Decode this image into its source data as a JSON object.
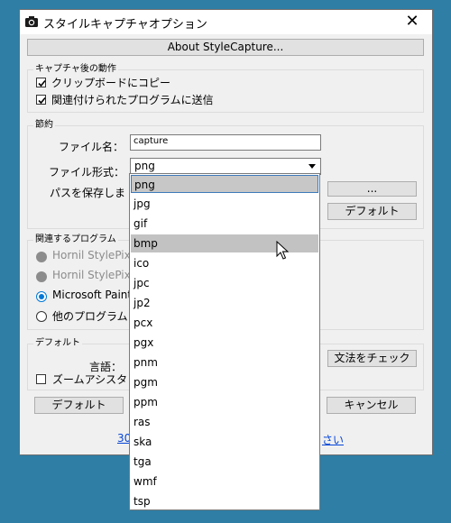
{
  "window": {
    "title": "スタイルキャプチャオプション"
  },
  "about_button": "About StyleCapture...",
  "capture_group": {
    "title": "キャプチャ後の動作",
    "options": [
      {
        "label": "クリップボードにコピー",
        "checked": true
      },
      {
        "label": "関連付けられたプログラムに送信",
        "checked": true
      }
    ]
  },
  "save_group": {
    "title": "節約",
    "filename_label": "ファイル名：",
    "filename_value": "capture",
    "format_label": "ファイル形式：",
    "format_value": "png",
    "path_label": "パスを保存しま",
    "browse_button": "...",
    "default_button": "デフォルト"
  },
  "program_group": {
    "title": "関連するプログラム",
    "options": [
      {
        "label": "Hornil StylePix",
        "selected": false,
        "enabled": false
      },
      {
        "label": "Hornil StylePix",
        "selected": false,
        "enabled": false
      },
      {
        "label": "Microsoft Paint",
        "selected": true,
        "enabled": true
      },
      {
        "label": "他のプログラム",
        "selected": false,
        "enabled": true
      }
    ]
  },
  "default_group": {
    "title": "デフォルト",
    "language_label": "言語：",
    "grammar_button": "文法をチェック",
    "zoom_assist_label": "ズームアシスタ",
    "zoom_assist_checked": false
  },
  "footer": {
    "default_button": "デフォルト",
    "cancel_button": "キャンセル",
    "link_left": "30",
    "link_right": "さい"
  },
  "dropdown": {
    "items": [
      "png",
      "jpg",
      "gif",
      "bmp",
      "ico",
      "jpc",
      "jp2",
      "pcx",
      "pgx",
      "pnm",
      "pgm",
      "ppm",
      "ras",
      "ska",
      "tga",
      "wmf",
      "tsp"
    ],
    "selected_index": 0,
    "hover_index": 3
  },
  "colors": {
    "desktop": "#2e7ea5",
    "selection_border": "#3d7bba",
    "selection_fill": "#c7c7c7",
    "hover_fill": "#c2c2c2",
    "radio_selected": "#0078d7"
  }
}
